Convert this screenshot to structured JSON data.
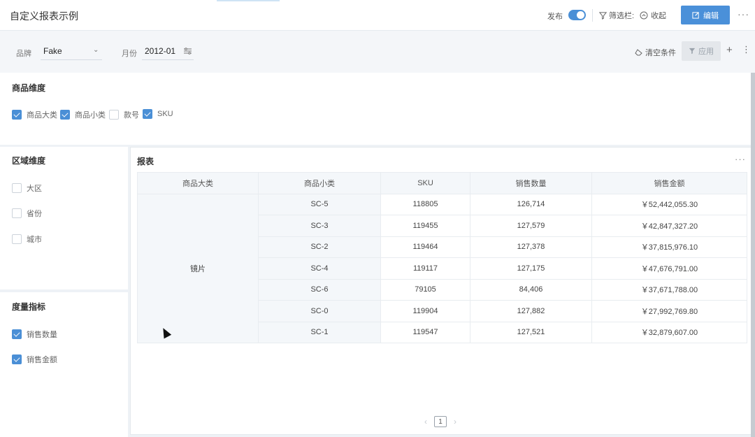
{
  "header": {
    "title": "自定义报表示例",
    "publish_label": "发布",
    "filter_bar_label": "筛选栏:",
    "collapse_label": "收起",
    "edit_label": "编辑"
  },
  "filters": {
    "brand_label": "品牌",
    "brand_value": "Fake",
    "month_label": "月份",
    "month_value": "2012-01",
    "clear_label": "清空条件",
    "apply_label": "应用"
  },
  "product_dimension": {
    "title": "商品维度",
    "items": [
      {
        "label": "商品大类",
        "checked": true
      },
      {
        "label": "商品小类",
        "checked": true
      },
      {
        "label": "款号",
        "checked": false
      },
      {
        "label": "SKU",
        "checked": true
      }
    ]
  },
  "region_dimension": {
    "title": "区域维度",
    "items": [
      {
        "label": "大区",
        "checked": false
      },
      {
        "label": "省份",
        "checked": false
      },
      {
        "label": "城市",
        "checked": false
      }
    ]
  },
  "metrics": {
    "title": "度量指标",
    "items": [
      {
        "label": "销售数量",
        "checked": true
      },
      {
        "label": "销售金额",
        "checked": true
      }
    ]
  },
  "report": {
    "title": "报表",
    "columns": [
      "商品大类",
      "商品小类",
      "SKU",
      "销售数量",
      "销售金额"
    ],
    "category": "镜片",
    "rows": [
      {
        "sub": "SC-5",
        "sku": "118805",
        "qty": "126,714",
        "amount": "￥52,442,055.30"
      },
      {
        "sub": "SC-3",
        "sku": "119455",
        "qty": "127,579",
        "amount": "￥42,847,327.20"
      },
      {
        "sub": "SC-2",
        "sku": "119464",
        "qty": "127,378",
        "amount": "￥37,815,976.10"
      },
      {
        "sub": "SC-4",
        "sku": "119117",
        "qty": "127,175",
        "amount": "￥47,676,791.00"
      },
      {
        "sub": "SC-6",
        "sku": "79105",
        "qty": "84,406",
        "amount": "￥37,671,788.00"
      },
      {
        "sub": "SC-0",
        "sku": "119904",
        "qty": "127,882",
        "amount": "￥27,992,769.80"
      },
      {
        "sub": "SC-1",
        "sku": "119547",
        "qty": "127,521",
        "amount": "￥32,879,607.00"
      }
    ],
    "page": "1"
  }
}
